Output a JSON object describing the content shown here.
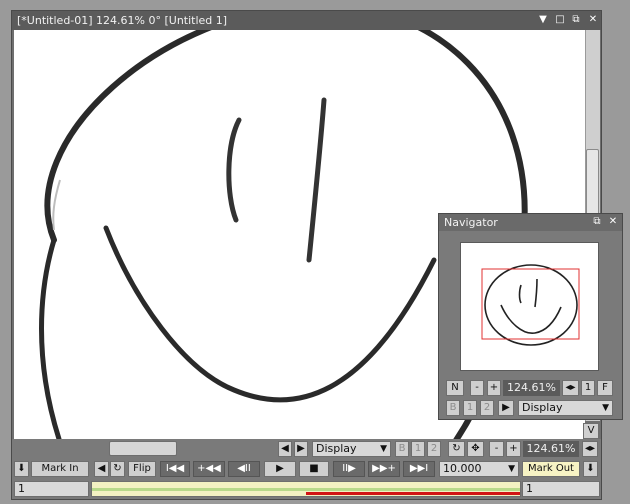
{
  "main_window": {
    "title": "[*Untitled-01]  124.61%   0°  [Untitled 1]",
    "controls": {
      "menu": "▼",
      "minimize": "□",
      "restore": "⧉",
      "close": "✕"
    }
  },
  "toolbar_row1": {
    "prev_arrow": "◀",
    "next_arrow": "▶",
    "display_select": "Display",
    "btn_b": "B",
    "btn_1": "1",
    "btn_2": "2",
    "rotate_icon": "↻",
    "settings_icon": "✥",
    "zoom_out": "-",
    "zoom_in": "+",
    "zoom_value": "124.61%",
    "fit_icon": "◂▸",
    "v_button": "V"
  },
  "toolbar_row2": {
    "down_arrow": "⬇",
    "mark_in": "Mark In",
    "sound_icon": "◀",
    "loop_icon": "↻",
    "flip": "Flip",
    "first": "I◀◀",
    "prev_key": "+◀◀",
    "step_back": "◀II",
    "play": "▶",
    "stop": "■",
    "step_fwd": "II▶",
    "next_key": "▶▶+",
    "last": "▶▶I",
    "fps_value": "10.000",
    "mark_out": "Mark Out",
    "down_arrow_right": "⬇"
  },
  "timeline": {
    "start_frame": "1",
    "end_frame": "1"
  },
  "navigator": {
    "title": "Navigator",
    "controls": {
      "restore": "⧉",
      "close": "✕"
    },
    "row1": {
      "n": "N",
      "minus": "-",
      "plus": "+",
      "zoom": "124.61%",
      "fit": "◂▸",
      "one": "1",
      "f": "F"
    },
    "row2": {
      "b": "B",
      "one": "1",
      "two": "2",
      "play": "▶",
      "display": "Display"
    }
  },
  "colors": {
    "viewport_rect": "#e03030",
    "playhead_range": "#d21414",
    "timeline_bg": "#f3f1c2"
  }
}
